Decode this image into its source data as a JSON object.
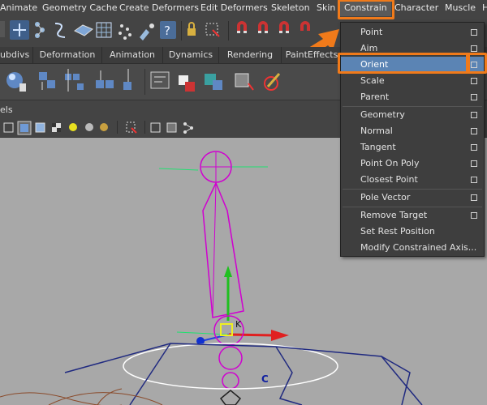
{
  "menubar": {
    "items": [
      "Animate",
      "Geometry Cache",
      "Create Deformers",
      "Edit Deformers",
      "Skeleton",
      "Skin",
      "Constrain",
      "Character",
      "Muscle",
      "H"
    ],
    "active": "Constrain"
  },
  "shelf_tabs": [
    "ubdivs",
    "Deformation",
    "Animation",
    "Dynamics",
    "Rendering",
    "PaintEffects"
  ],
  "panel_header": "els",
  "constrain_menu": {
    "items": [
      {
        "label": "Point",
        "option": true
      },
      {
        "label": "Aim",
        "option": true
      },
      {
        "label": "Orient",
        "option": true,
        "selected": true
      },
      {
        "label": "Scale",
        "option": true
      },
      {
        "label": "Parent",
        "option": true
      },
      {
        "label": "Geometry",
        "option": true
      },
      {
        "label": "Normal",
        "option": true
      },
      {
        "label": "Tangent",
        "option": true
      },
      {
        "label": "Point On Poly",
        "option": true
      },
      {
        "label": "Closest Point",
        "option": true
      },
      {
        "label": "Pole Vector",
        "option": true
      },
      {
        "label": "Remove Target",
        "option": true
      },
      {
        "label": "Set Rest Position",
        "option": false
      },
      {
        "label": "Modify Constrained Axis...",
        "option": false
      }
    ]
  },
  "viewport_labels": {
    "k_label": "K",
    "c_label": "C"
  },
  "colors": {
    "highlight": "#f07a1a",
    "selected_item": "#5b84b4",
    "viewport_bg": "#a8a8a8",
    "joint": "#d000d0"
  },
  "icons": {
    "toolbar": [
      "move-tool-icon",
      "joint-chain-icon",
      "curve-icon",
      "plane-icon",
      "lattice-icon",
      "cluster-icon",
      "paint-icon",
      "help-icon",
      "lock-icon",
      "select-icon",
      "magnet-icon"
    ],
    "shelf": [
      "sphere-icon",
      "ik-handle-icon",
      "bind-skin-icon",
      "paint-weights-icon",
      "hud-icon",
      "constraint-icon"
    ]
  }
}
